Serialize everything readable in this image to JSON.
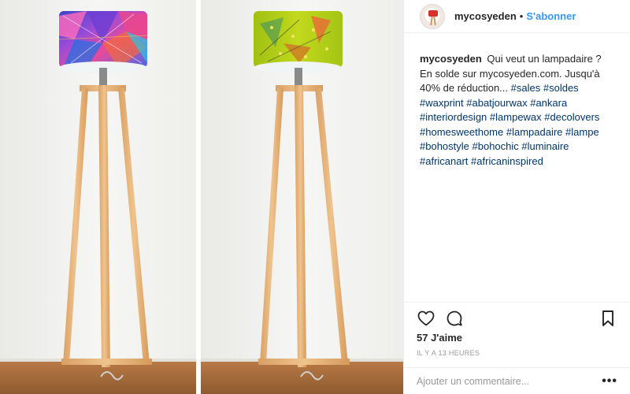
{
  "post": {
    "username": "mycosyeden",
    "separator": "•",
    "follow_label": "S'abonner",
    "caption": {
      "username": "mycosyeden",
      "text": "Qui veut un lampadaire ? En solde sur mycosyeden.com. Jusqu'à 40% de réduction...",
      "hashtags": [
        "#sales",
        "#soldes",
        "#waxprint",
        "#abatjourwax",
        "#ankara",
        "#interiordesign",
        "#lampewax",
        "#decolovers",
        "#homesweethome",
        "#lampadaire",
        "#lampe",
        "#bohostyle",
        "#bohochic",
        "#luminaire",
        "#africanart",
        "#africaninspired"
      ]
    },
    "likes": "57 J'aime",
    "time": "IL Y A 13 HEURES",
    "comment_placeholder": "Ajouter un commentaire...",
    "more_label": "•••"
  },
  "icons": {
    "like": "heart-icon",
    "comment": "comment-bubble-icon",
    "save": "bookmark-icon",
    "more": "more-options-icon"
  },
  "colors": {
    "link": "#3897f0",
    "hashtag": "#003569",
    "text": "#262626",
    "muted": "#999999",
    "shade_left": "#5a4fc8",
    "shade_right": "#b7cf16",
    "wood": "#e2ad72"
  }
}
